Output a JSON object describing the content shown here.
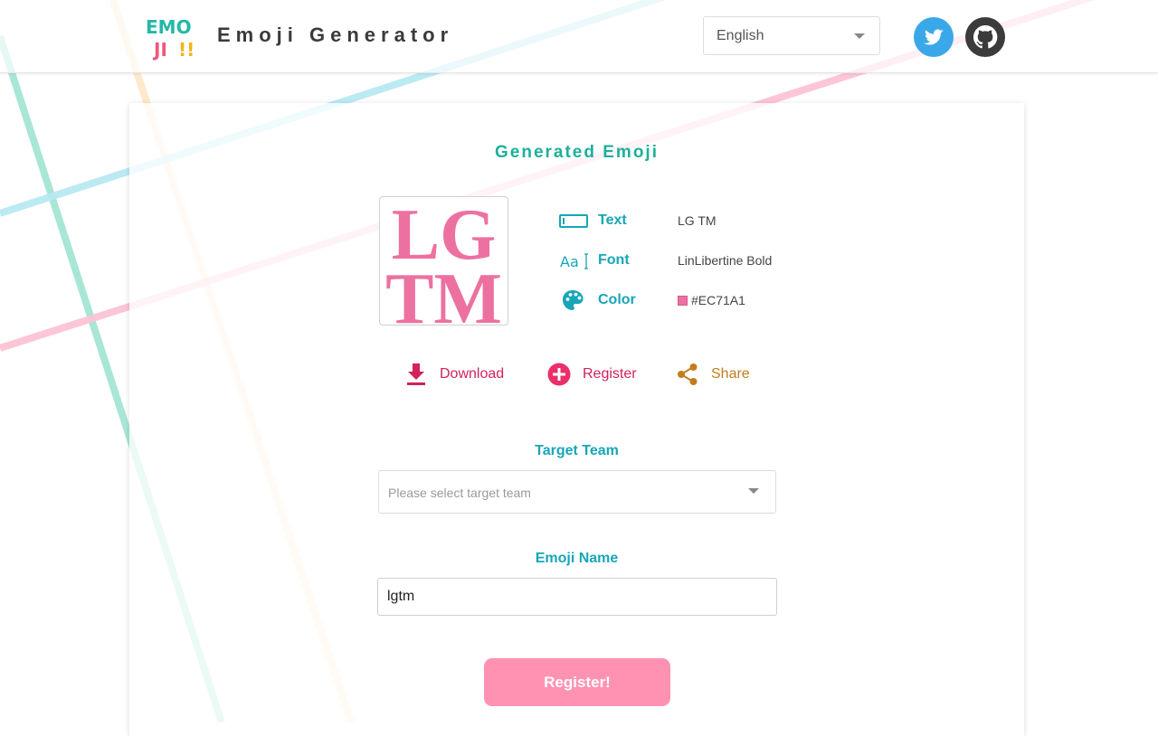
{
  "header": {
    "logo": {
      "line1": "EMO",
      "line2": "JI",
      "marks": "!!"
    },
    "title": "Emoji Generator",
    "language_select": {
      "value": "English"
    }
  },
  "card": {
    "title": "Generated Emoji",
    "preview": {
      "line1": "LG",
      "line2": "TM",
      "color": "#EC71A1"
    },
    "info": {
      "text": {
        "label": "Text",
        "value": "LG TM"
      },
      "font": {
        "label": "Font",
        "value": "LinLibertine Bold",
        "icon_text": "Aa"
      },
      "color": {
        "label": "Color",
        "value": "#EC71A1"
      }
    },
    "actions": {
      "download": "Download",
      "register": "Register",
      "share": "Share"
    },
    "target_team": {
      "label": "Target Team",
      "placeholder": "Please select target team"
    },
    "emoji_name": {
      "label": "Emoji Name",
      "value": "lgtm"
    },
    "submit_label": "Register!"
  },
  "icons": {
    "language": "chevron-down-icon",
    "twitter": "twitter-bird-icon",
    "github": "github-octocat-icon",
    "text": "text-field-icon",
    "font": "font-icon",
    "color": "palette-icon",
    "download": "download-arrow-icon",
    "register": "plus-circle-icon",
    "share": "share-icon"
  },
  "colors": {
    "accent_teal": "#17a6b8",
    "title_green": "#1cb09a",
    "pink_action": "#d3215a",
    "share_orange": "#c27d1e",
    "button_pink": "#ff92b2"
  }
}
